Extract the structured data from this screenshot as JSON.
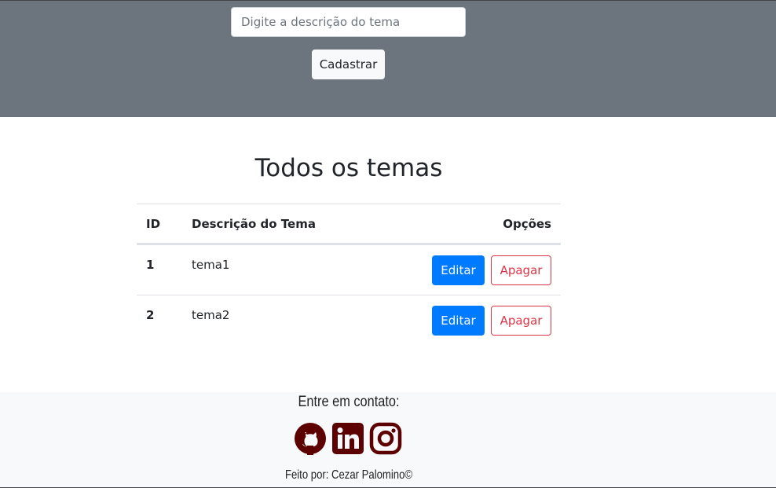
{
  "form": {
    "placeholder": "Digite a descrição do tema",
    "value": "",
    "submit_label": "Cadastrar"
  },
  "main": {
    "title": "Todos os temas",
    "table": {
      "headers": [
        "ID",
        "Descrição do Tema",
        "Opções"
      ],
      "rows": [
        {
          "id": "1",
          "descricao": "tema1",
          "edit_label": "Editar",
          "delete_label": "Apagar"
        },
        {
          "id": "2",
          "descricao": "tema2",
          "edit_label": "Editar",
          "delete_label": "Apagar"
        }
      ]
    }
  },
  "footer": {
    "contact_title": "Entre em contato:",
    "social": [
      {
        "icon": "github-icon"
      },
      {
        "icon": "linkedin-icon"
      },
      {
        "icon": "instagram-icon"
      }
    ],
    "credits": "Feito por: Cezar Palomino©"
  },
  "colors": {
    "header_bg": "#6c757d",
    "primary": "#007bff",
    "danger": "#dc3545",
    "footer_bg": "#f8f9fa",
    "social_icon": "#5c0000"
  }
}
